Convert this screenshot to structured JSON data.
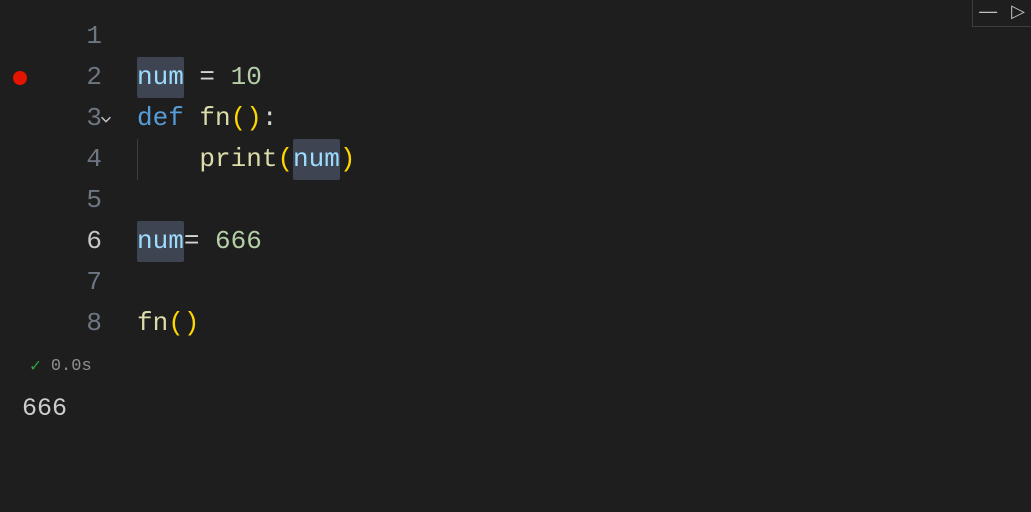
{
  "editor": {
    "lines": [
      {
        "num": "1",
        "fold": "",
        "bp": false,
        "tokens": []
      },
      {
        "num": "2",
        "fold": "",
        "bp": true,
        "tokens": [
          {
            "t": "num",
            "c": "tk-var highlight"
          },
          {
            "t": " ",
            "c": ""
          },
          {
            "t": "=",
            "c": "tk-op"
          },
          {
            "t": " ",
            "c": ""
          },
          {
            "t": "10",
            "c": "tk-num"
          }
        ]
      },
      {
        "num": "3",
        "fold": "v",
        "bp": false,
        "tokens": [
          {
            "t": "def",
            "c": "tk-kw"
          },
          {
            "t": " ",
            "c": ""
          },
          {
            "t": "fn",
            "c": "tk-fn"
          },
          {
            "t": "(",
            "c": "tk-par"
          },
          {
            "t": ")",
            "c": "tk-par"
          },
          {
            "t": ":",
            "c": "tk-op"
          }
        ]
      },
      {
        "num": "4",
        "fold": "",
        "bp": false,
        "tokens": [
          {
            "t": "    ",
            "c": "indent"
          },
          {
            "t": "print",
            "c": "tk-fn"
          },
          {
            "t": "(",
            "c": "tk-par"
          },
          {
            "t": "num",
            "c": "tk-var highlight"
          },
          {
            "t": ")",
            "c": "tk-par"
          }
        ]
      },
      {
        "num": "5",
        "fold": "",
        "bp": false,
        "tokens": []
      },
      {
        "num": "6",
        "fold": "",
        "bp": false,
        "active": true,
        "tokens": [
          {
            "t": "num",
            "c": "tk-var highlight"
          },
          {
            "t": "=",
            "c": "tk-op"
          },
          {
            "t": " ",
            "c": ""
          },
          {
            "t": "666",
            "c": "tk-num"
          }
        ]
      },
      {
        "num": "7",
        "fold": "",
        "bp": false,
        "tokens": []
      },
      {
        "num": "8",
        "fold": "",
        "bp": false,
        "tokens": [
          {
            "t": "fn",
            "c": "tk-fn"
          },
          {
            "t": "(",
            "c": "tk-par"
          },
          {
            "t": ")",
            "c": "tk-par"
          }
        ]
      }
    ]
  },
  "status": {
    "time": "0.0s",
    "icon": "check"
  },
  "output": {
    "text": "666"
  },
  "corner": {
    "minimize": "—",
    "run": "▷"
  }
}
